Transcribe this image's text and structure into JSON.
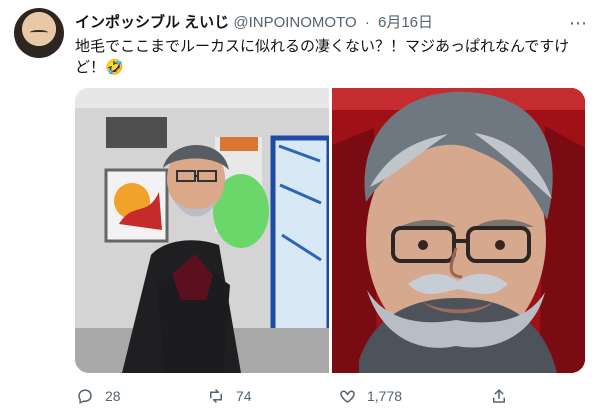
{
  "tweet": {
    "display_name": "インポッシブル えいじ",
    "handle": "@INPOINOMOTO",
    "separator": "·",
    "date": "6月16日",
    "more_label": "⋯",
    "text": "地毛でここまでルーカスに似れるの凄くない？！マジあっぱれなんですけど！🤣"
  },
  "stats": {
    "replies": "28",
    "retweets": "74",
    "likes": "1,778"
  },
  "icons": {
    "reply": "comment-icon",
    "retweet": "retweet-icon",
    "like": "heart-icon",
    "share": "share-icon"
  },
  "colors": {
    "text": "#0f1419",
    "muted": "#536471"
  }
}
